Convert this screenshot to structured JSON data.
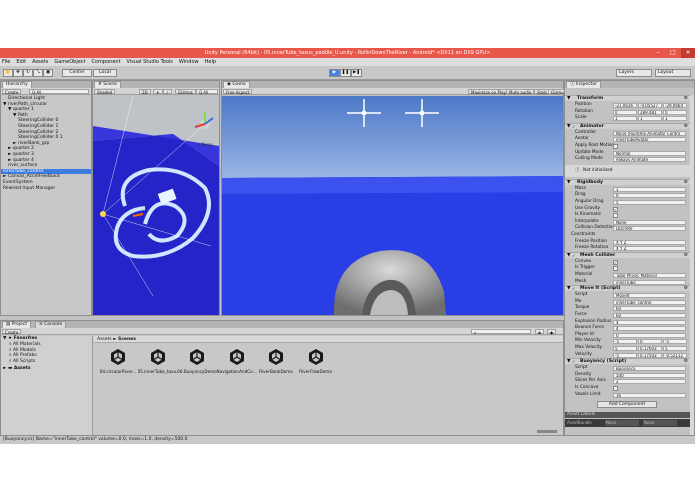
{
  "window": {
    "title": "Unity Personal (64bit) - 05.innerTube_taxus_paddle_U.unity - RollinDownTheRiver - Android* <DX11 on DX9 GPU>",
    "controls": {
      "minimize": "–",
      "maximize": "□",
      "close": "✕"
    }
  },
  "menu": [
    "File",
    "Edit",
    "Assets",
    "GameObject",
    "Component",
    "Visual Studio Tools",
    "Window",
    "Help"
  ],
  "toolbar": {
    "pivot": "Center",
    "space": "Local",
    "play": "▶",
    "pause": "❚❚",
    "step": "▶❚",
    "layers": "Layers",
    "layout": "Layout"
  },
  "hierarchy": {
    "tab": "Hierarchy",
    "create": "Create",
    "search_placeholder": "Q·All",
    "items": [
      {
        "label": "Directional Light",
        "depth": 1,
        "selected": false
      },
      {
        "label": "▼ riverPath_circular",
        "depth": 0,
        "selected": false
      },
      {
        "label": "▼ quarter 1",
        "depth": 1,
        "selected": false
      },
      {
        "label": "▼ Path",
        "depth": 2,
        "selected": false
      },
      {
        "label": "SteeringCollider 0",
        "depth": 3,
        "selected": false
      },
      {
        "label": "SteeringCollider 1",
        "depth": 3,
        "selected": false
      },
      {
        "label": "SteeringCollider 2",
        "depth": 3,
        "selected": false
      },
      {
        "label": "SteeringCollider 0 1",
        "depth": 3,
        "selected": false
      },
      {
        "label": "► riverBank_grp",
        "depth": 2,
        "selected": false
      },
      {
        "label": "► quarter 2",
        "depth": 1,
        "selected": false
      },
      {
        "label": "► quarter 3",
        "depth": 1,
        "selected": false
      },
      {
        "label": "► quarter 4",
        "depth": 1,
        "selected": false
      },
      {
        "label": "river_surface",
        "depth": 1,
        "selected": false
      },
      {
        "label": "innerTube_control",
        "depth": 0,
        "selected": true
      },
      {
        "label": "► Canvas_AccelFeedback",
        "depth": 0,
        "selected": false
      },
      {
        "label": "EventSystem",
        "depth": 0,
        "selected": false
      },
      {
        "label": "Rewired Input Manager",
        "depth": 0,
        "selected": false
      }
    ]
  },
  "scene": {
    "tab": "Scene",
    "shading": "Shaded",
    "mode": "2D",
    "gizmos": "Gizmos",
    "search_placeholder": "Q·All",
    "persp_label": "< Persp"
  },
  "game": {
    "tab": "Game",
    "aspect": "Free Aspect",
    "maximize": "Maximize on Play",
    "mute": "Mute audio",
    "stats": "Stats",
    "gizmos": "Gizmos"
  },
  "inspector": {
    "tab": "Inspector",
    "transform": {
      "title": "Transform",
      "rows": [
        {
          "label": "Position",
          "x": "-21.0636",
          "y": "-0.05527",
          "z": "-29.0664"
        },
        {
          "label": "Rotation",
          "x": "0",
          "y": "289.481",
          "z": "0"
        },
        {
          "label": "Scale",
          "x": "1",
          "y": "1",
          "z": "1"
        }
      ]
    },
    "animator": {
      "title": "Animator",
      "rows": [
        {
          "label": "Controller",
          "value": "None (Runtime Animator Contro"
        },
        {
          "label": "Avatar",
          "value": "innerTubeAvatar"
        },
        {
          "label": "Apply Root Motion",
          "value": ""
        },
        {
          "label": "Update Mode",
          "value": "Normal"
        },
        {
          "label": "Culling Mode",
          "value": "Always Animate"
        }
      ],
      "note": "Not initialized"
    },
    "rigidbody": {
      "title": "Rigidbody",
      "rows": [
        {
          "label": "Mass",
          "value": "1"
        },
        {
          "label": "Drag",
          "value": "0"
        },
        {
          "label": "Angular Drag",
          "value": "5"
        },
        {
          "label": "Use Gravity",
          "value": "✓"
        },
        {
          "label": "Is Kinematic",
          "value": ""
        },
        {
          "label": "Interpolate",
          "value": "None"
        },
        {
          "label": "Collision Detection",
          "value": "Discrete"
        },
        {
          "label": "Constraints",
          "value": ""
        },
        {
          "label": "Freeze Position",
          "value": "X  Y  Z"
        },
        {
          "label": "Freeze Rotation",
          "value": "X  Y  Z"
        }
      ]
    },
    "mesh_collider": {
      "title": "Mesh Collider",
      "rows": [
        {
          "label": "Convex",
          "value": "✓"
        },
        {
          "label": "Is Trigger",
          "value": ""
        },
        {
          "label": "Material",
          "value": "Tube Physic Material"
        },
        {
          "label": "Mesh",
          "value": "innerTube"
        }
      ]
    },
    "move_it": {
      "title": "Move It (Script)",
      "rows": [
        {
          "label": "Script",
          "value": "MoveIt"
        },
        {
          "label": "Me",
          "value": "innerTube_control"
        },
        {
          "label": "Torque",
          "value": "60"
        },
        {
          "label": "Force",
          "value": "60"
        },
        {
          "label": "Explosion Radius",
          "value": "4"
        },
        {
          "label": "Bounce Force",
          "value": "4"
        },
        {
          "label": "Player Id",
          "value": "0"
        }
      ],
      "vec_rows": [
        {
          "label": "Min Velocity",
          "x": "-5",
          "y": "0",
          "z": "-5"
        },
        {
          "label": "Max Velocity",
          "x": "5",
          "y": "0.17603",
          "z": "5"
        },
        {
          "label": "Velocity",
          "x": "-5",
          "y": "0.17503",
          "z": "-0.52112"
        }
      ]
    },
    "buoyancy": {
      "title": "Buoyancy (Script)",
      "rows": [
        {
          "label": "Script",
          "value": "Buoyancy"
        },
        {
          "label": "Density",
          "value": "500"
        },
        {
          "label": "Slices Per Axis",
          "value": "2"
        },
        {
          "label": "Is Concave",
          "value": ""
        },
        {
          "label": "Voxels Limit",
          "value": "16"
        }
      ]
    },
    "add_component": "Add Component",
    "asset_labels": "Asset Labels",
    "asset_bundle": "AssetBundle",
    "asset_bundle_none": "None",
    "asset_bundle_none2": "None"
  },
  "project": {
    "tab": "Project",
    "console_tab": "Console",
    "create": "Create",
    "favorites_title": "Favorites",
    "favorites": [
      "All Materials",
      "All Models",
      "All Prefabs",
      "All Scripts"
    ],
    "assets_title": "Assets",
    "breadcrumb_root": "Assets",
    "breadcrumb_sep": "►",
    "breadcrumb_folder": "Scenes",
    "items": [
      "04.circularRiver...",
      "05.innerTube_taxu...",
      "06.BuoyancyDemo",
      "NavigationAndCo...",
      "RiverBankDemo",
      "RiverFlowDemo"
    ]
  },
  "status": "[Buoyancy.cs] Name=\"innerTube_control\" volume=0.0, mass=1.0, density=500.0",
  "colors": {
    "title_bar": "#e8574a",
    "selection": "#3e7de0",
    "river_blue": "#2424c8",
    "sky_top": "#4d78c8",
    "water": "#2a3ee6"
  }
}
